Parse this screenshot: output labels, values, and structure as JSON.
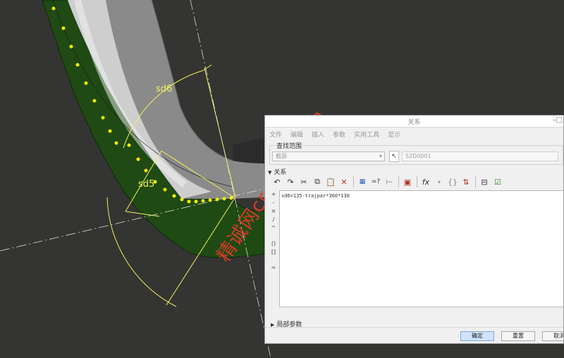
{
  "viewport": {
    "dimensions": [
      {
        "label": "sd6"
      },
      {
        "label": "sd5"
      }
    ],
    "watermark": "精诚网creoug.com",
    "colors": {
      "background": "#343432",
      "surface_green": "#1f4a14",
      "dimension": "#f2ef5a",
      "watermark": "#e03a2a"
    }
  },
  "dialog": {
    "title": "关系",
    "menu": [
      "文件",
      "编辑",
      "插入",
      "参数",
      "实用工具",
      "显示"
    ],
    "search_scope": {
      "label": "查找范围",
      "type_value": "截面",
      "selection_value": "S2D0001"
    },
    "relations_section": {
      "label": "关系",
      "text": "sd6=135-trajpar*360*130"
    },
    "toolbar_icons": [
      "undo-icon",
      "redo-icon",
      "cut-icon",
      "copy-icon",
      "paste-icon",
      "delete-icon",
      "show-values-icon",
      "evaluate-icon",
      "dimension-icon",
      "verify-icon",
      "function-icon",
      "brackets-icon",
      "sort-icon",
      "execute-icon",
      "check-icon"
    ],
    "side_ops": [
      "+",
      "-",
      "×",
      "/",
      "^",
      "()",
      "[]",
      "="
    ],
    "local_params_label": "局部参数",
    "buttons": {
      "ok": "确定",
      "reset": "重置",
      "cancel": "取消"
    }
  }
}
